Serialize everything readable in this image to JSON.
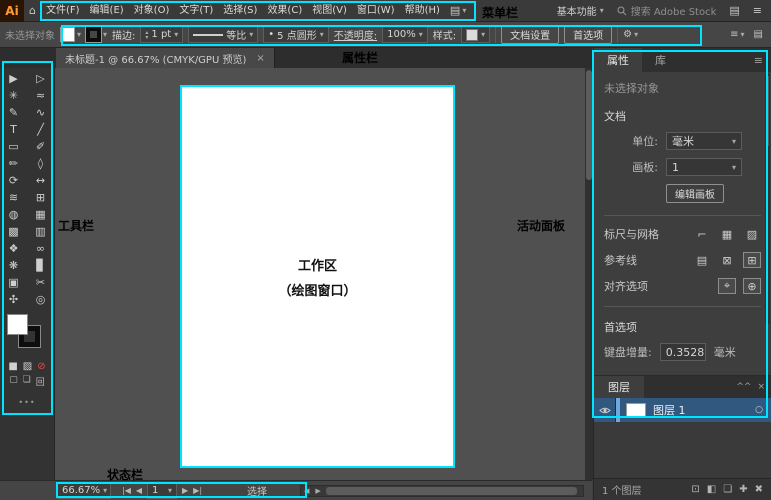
{
  "annotations": {
    "accent_color": "#00e5ff",
    "menu_bar": "菜单栏",
    "control_bar": "属性栏",
    "toolbar": "工具栏",
    "panel": "活动面板",
    "status_bar": "状态栏",
    "workspace_line1": "工作区",
    "workspace_line2": "（绘图窗口）"
  },
  "icons": {
    "home": "⌂",
    "chevron": "▾",
    "up": "▴",
    "down": "▾",
    "dot": "•",
    "menu": "≡",
    "grid": "▤",
    "gear": "⚙",
    "close": "×",
    "collapse": "^^",
    "target": "○",
    "first": "|◀",
    "prev": "◀",
    "next": "▶",
    "last": "▶|",
    "ellipsis": "•••"
  },
  "menu_bar": {
    "logo": "Ai",
    "items": [
      {
        "key": "file",
        "label": "文件(F)"
      },
      {
        "key": "edit",
        "label": "编辑(E)"
      },
      {
        "key": "object",
        "label": "对象(O)"
      },
      {
        "key": "type",
        "label": "文字(T)"
      },
      {
        "key": "select",
        "label": "选择(S)"
      },
      {
        "key": "effect",
        "label": "效果(C)"
      },
      {
        "key": "view",
        "label": "视图(V)"
      },
      {
        "key": "window",
        "label": "窗口(W)"
      },
      {
        "key": "help",
        "label": "帮助(H)"
      }
    ],
    "workspace_switcher": "基本功能",
    "search_placeholder": "搜索 Adobe Stock"
  },
  "control_bar": {
    "no_selection": "未选择对象",
    "stroke_label": "描边:",
    "stroke_value": "1 pt",
    "profile_value": "等比",
    "brush_value": "5 点圆形",
    "opacity_label": "不透明度:",
    "opacity_value": "100%",
    "style_label": "样式:",
    "document_setup": "文档设置",
    "preferences": "首选项"
  },
  "document_tab": {
    "title": "未标题-1 @ 66.67% (CMYK/GPU 预览)",
    "close": "×"
  },
  "toolbar": {
    "tools": [
      {
        "name": "selection-tool",
        "glyph": "▶"
      },
      {
        "name": "direct-selection-tool",
        "glyph": "▷"
      },
      {
        "name": "magic-wand-tool",
        "glyph": "✳"
      },
      {
        "name": "lasso-tool",
        "glyph": "≈"
      },
      {
        "name": "pen-tool",
        "glyph": "✎"
      },
      {
        "name": "curvature-tool",
        "glyph": "∿"
      },
      {
        "name": "type-tool",
        "glyph": "T"
      },
      {
        "name": "line-segment-tool",
        "glyph": "╱"
      },
      {
        "name": "rectangle-tool",
        "glyph": "▭"
      },
      {
        "name": "paintbrush-tool",
        "glyph": "✐"
      },
      {
        "name": "shaper-tool",
        "glyph": "✏"
      },
      {
        "name": "eraser-tool",
        "glyph": "◊"
      },
      {
        "name": "rotate-tool",
        "glyph": "⟳"
      },
      {
        "name": "scale-tool",
        "glyph": "↔"
      },
      {
        "name": "width-tool",
        "glyph": "≋"
      },
      {
        "name": "free-transform-tool",
        "glyph": "⊞"
      },
      {
        "name": "shape-builder-tool",
        "glyph": "◍"
      },
      {
        "name": "perspective-grid-tool",
        "glyph": "▦"
      },
      {
        "name": "mesh-tool",
        "glyph": "▩"
      },
      {
        "name": "gradient-tool",
        "glyph": "▥"
      },
      {
        "name": "eyedropper-tool",
        "glyph": "❖"
      },
      {
        "name": "blend-tool",
        "glyph": "∞"
      },
      {
        "name": "symbol-sprayer-tool",
        "glyph": "❋"
      },
      {
        "name": "column-graph-tool",
        "glyph": "▊"
      },
      {
        "name": "artboard-tool",
        "glyph": "▣"
      },
      {
        "name": "slice-tool",
        "glyph": "✂"
      },
      {
        "name": "hand-tool",
        "glyph": "✣"
      },
      {
        "name": "zoom-tool",
        "glyph": "◎"
      }
    ],
    "color_modes": [
      {
        "name": "color-fill-icon",
        "glyph": "■"
      },
      {
        "name": "gradient-icon",
        "glyph": "▨"
      },
      {
        "name": "none-icon",
        "glyph": "⊘"
      }
    ],
    "draw_modes": [
      {
        "name": "draw-normal-icon",
        "glyph": "▢"
      },
      {
        "name": "draw-behind-icon",
        "glyph": "❏"
      },
      {
        "name": "draw-inside-icon",
        "glyph": "回"
      }
    ]
  },
  "properties_panel": {
    "tabs": [
      {
        "label": "属性"
      },
      {
        "label": "库"
      }
    ],
    "no_selection": "未选择对象",
    "document_section": "文档",
    "unit_label": "单位:",
    "unit_value": "毫米",
    "artboard_label": "画板:",
    "artboard_value": "1",
    "edit_artboard": "编辑画板",
    "rulers_grid_label": "标尺与网格",
    "rulers_icons": [
      {
        "name": "show-rulers-icon",
        "glyph": "⌐"
      },
      {
        "name": "show-grid-icon",
        "glyph": "▦"
      },
      {
        "name": "show-transparency-grid-icon",
        "glyph": "▨"
      }
    ],
    "guides_label": "参考线",
    "guides_icons": [
      {
        "name": "show-guides-icon",
        "glyph": "▤"
      },
      {
        "name": "lock-guides-icon",
        "glyph": "⊠"
      },
      {
        "name": "guides-options-icon",
        "glyph": "⊞",
        "toggled": true
      }
    ],
    "snap_label": "对齐选项",
    "snap_icons": [
      {
        "name": "snap-to-grid-icon",
        "glyph": "⌖",
        "toggled": true
      },
      {
        "name": "snap-to-point-icon",
        "glyph": "⊕",
        "toggled": true
      }
    ],
    "preferences_section": "首选项",
    "key_increment_label": "键盘增量:",
    "key_increment_value": "0.3528",
    "key_increment_unit": "毫米"
  },
  "layers_panel": {
    "title": "图层",
    "rows": [
      {
        "name": "图层 1"
      }
    ],
    "count_text": "1 个图层",
    "footer_icons": [
      {
        "name": "collect-export-icon",
        "glyph": "⊡"
      },
      {
        "name": "make-mask-icon",
        "glyph": "◧"
      },
      {
        "name": "new-sublayer-icon",
        "glyph": "❏"
      },
      {
        "name": "new-layer-icon",
        "glyph": "✚"
      },
      {
        "name": "delete-layer-icon",
        "glyph": "✖"
      }
    ]
  },
  "status_bar": {
    "zoom": "66.67%",
    "artboard_number": "1",
    "status_text": "选择"
  }
}
